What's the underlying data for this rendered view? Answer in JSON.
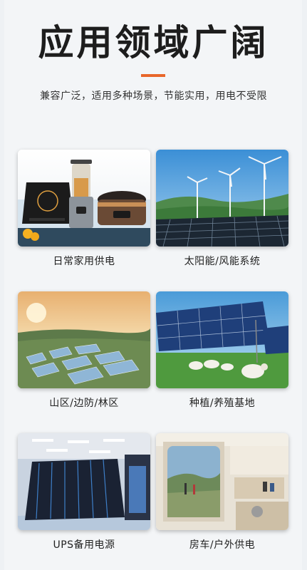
{
  "header": {
    "title": "应用领域广阔",
    "subtitle": "兼容广泛，适用多种场景，节能实用，用电不受限"
  },
  "colors": {
    "accent": "#e8662a",
    "background": "#f3f5f7"
  },
  "applications": [
    {
      "label": "日常家用供电"
    },
    {
      "label": "太阳能/风能系统"
    },
    {
      "label": "山区/边防/林区"
    },
    {
      "label": "种植/养殖基地"
    },
    {
      "label": "UPS备用电源"
    },
    {
      "label": "房车/户外供电"
    }
  ]
}
